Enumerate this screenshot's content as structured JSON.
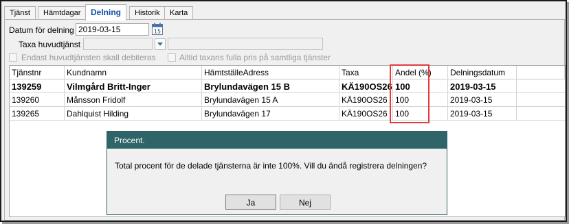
{
  "tabs": [
    {
      "label": "Tjänst",
      "active": false
    },
    {
      "label": "Hämtdagar",
      "active": false
    },
    {
      "label": "Delning",
      "active": true
    },
    {
      "label": "Historik",
      "active": false
    },
    {
      "label": "Karta",
      "active": false
    }
  ],
  "form": {
    "datum_label": "Datum för delning",
    "datum_value": "2019-03-15",
    "calendar_day": "15",
    "taxa_label": "Taxa huvudtjänst",
    "taxa_value": "",
    "taxa_desc": "",
    "chk_endast": "Endast huvudtjänsten skall debiteras",
    "chk_alltid": "Alltid taxans fulla pris på samtliga tjänster"
  },
  "grid": {
    "columns": [
      "Tjänstnr",
      "Kundnamn",
      "HämtställeAdress",
      "Taxa",
      "Andel (%)",
      "Delningsdatum",
      ""
    ],
    "rows": [
      {
        "cells": [
          "139259",
          "Vilmgård Britt-Inger",
          "Brylundavägen 15 B",
          "KÄ190OS26",
          "100",
          "2019-03-15"
        ],
        "bold": true
      },
      {
        "cells": [
          "139260",
          "Månsson Fridolf",
          "Brylundavägen 15 A",
          "KÄ190OS26",
          "100",
          "2019-03-15"
        ],
        "bold": false
      },
      {
        "cells": [
          "139265",
          "Dahlquist Hilding",
          "Brylundavägen 17",
          "KÄ190OS26",
          "100",
          "2019-03-15"
        ],
        "bold": false
      }
    ]
  },
  "dialog": {
    "title": "Procent.",
    "message": "Total procent för de delade tjänsterna är inte 100%. Vill du ändå registrera delningen?",
    "yes_label": "Ja",
    "no_label": "Nej"
  },
  "colors": {
    "accent_tab": "#0a4fa8",
    "dialog_title_bg": "#2f6569",
    "highlight": "#e23b3b"
  }
}
